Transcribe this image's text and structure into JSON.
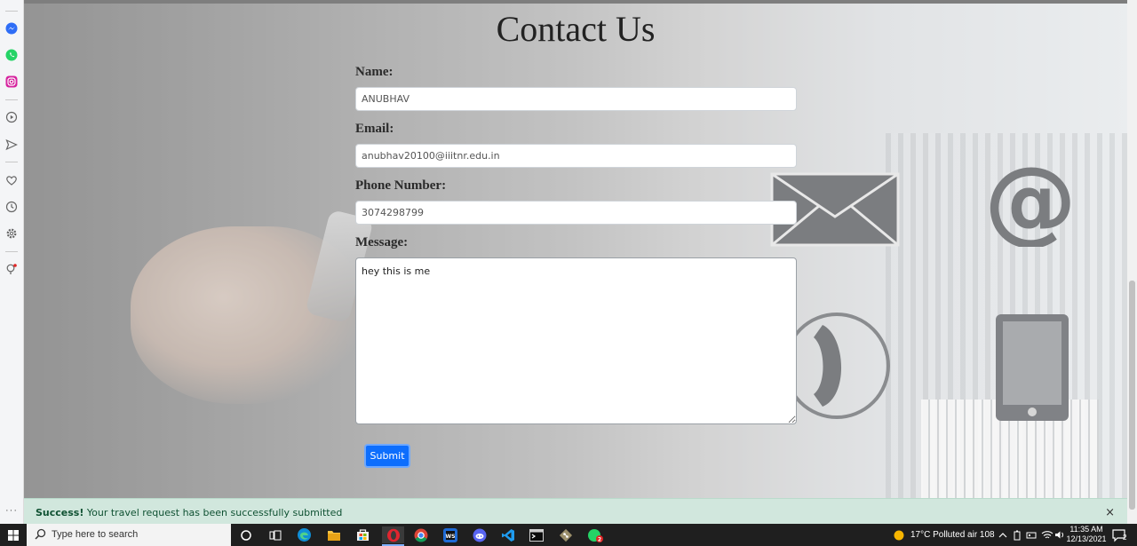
{
  "page": {
    "title": "Contact Us"
  },
  "form": {
    "name_label": "Name:",
    "name_value": "ANUBHAV",
    "email_label": "Email:",
    "email_value": "anubhav20100@iiitnr.edu.in",
    "phone_label": "Phone Number:",
    "phone_value": "3074298799",
    "message_label": "Message:",
    "message_value": "hey this is me",
    "submit_label": "Submit"
  },
  "alert": {
    "strong": "Success!",
    "text": " Your travel request has been successfully submitted",
    "close": "×"
  },
  "sidebar": {
    "icons": [
      "messenger-icon",
      "whatsapp-icon",
      "instagram-icon",
      "player-icon",
      "send-icon",
      "heart-icon",
      "history-icon",
      "gear-icon",
      "bulb-icon"
    ],
    "more": "···"
  },
  "taskbar": {
    "search_placeholder": "Type here to search",
    "weather": "17°C  Polluted air 108",
    "time": "11:35 AM",
    "date": "12/13/2021",
    "notification_count": "2",
    "apps": [
      "cortana-icon",
      "task-view-icon",
      "edge-icon",
      "file-explorer-icon",
      "store-icon",
      "opera-icon",
      "chrome-icon",
      "webstorm-icon",
      "discord-icon",
      "vscode-icon",
      "terminal-icon",
      "git-icon",
      "whatsapp-icon"
    ],
    "whatsapp_badge": "2"
  },
  "colors": {
    "accent": "#0d6efd",
    "alert_bg": "#d1e7dd",
    "alert_text": "#0f5132"
  }
}
